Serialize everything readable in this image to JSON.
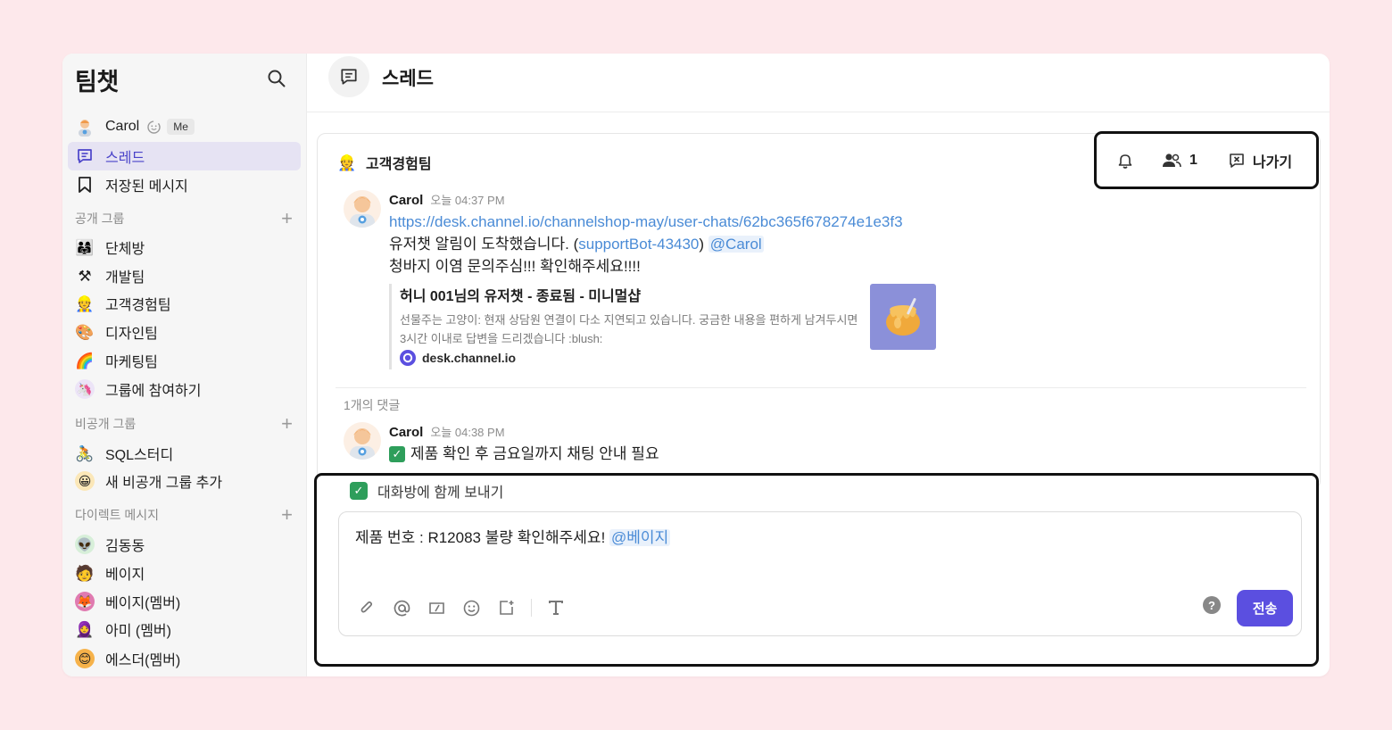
{
  "sidebar": {
    "title": "팀챗",
    "me": {
      "name": "Carol",
      "badge": "Me"
    },
    "nav": [
      {
        "label": "스레드",
        "icon": "thread-icon",
        "active": true
      },
      {
        "label": "저장된 메시지",
        "icon": "bookmark-icon",
        "active": false
      }
    ],
    "public_groups": {
      "header": "공개 그룹",
      "items": [
        {
          "label": "단체방",
          "icon": "family-emoji-icon"
        },
        {
          "label": "개발팀",
          "icon": "hammer-pick-icon"
        },
        {
          "label": "고객경험팀",
          "icon": "worker-emoji-icon"
        },
        {
          "label": "디자인팀",
          "icon": "palette-icon"
        },
        {
          "label": "마케팅팀",
          "icon": "rainbow-icon"
        },
        {
          "label": "그룹에 참여하기",
          "icon": "unicorn-icon"
        }
      ]
    },
    "private_groups": {
      "header": "비공개 그룹",
      "items": [
        {
          "label": "SQL스터디",
          "icon": "cyclist-lock-icon"
        },
        {
          "label": "새 비공개 그룹 추가",
          "icon": "smile-icon"
        }
      ]
    },
    "direct_messages": {
      "header": "다이렉트 메시지",
      "items": [
        {
          "label": "김동동",
          "icon": "alien-icon"
        },
        {
          "label": "베이지",
          "icon": "person-icon"
        },
        {
          "label": "베이지(멤버)",
          "icon": "fox-icon"
        },
        {
          "label": "아미 (멤버)",
          "icon": "person-moon-icon"
        },
        {
          "label": "에스더(멤버)",
          "icon": "blush-icon"
        }
      ]
    }
  },
  "header": {
    "title": "스레드"
  },
  "thread": {
    "group_name": "고객경험팀",
    "actions": {
      "member_count": "1",
      "leave_label": "나가기"
    },
    "message": {
      "author": "Carol",
      "time": "오늘 04:37 PM",
      "link": "https://desk.channel.io/channelshop-may/user-chats/62bc365f678274e1e3f3",
      "line2_prefix": "유저챗 알림이 도착했습니다. (",
      "line2_bot": "supportBot-43430",
      "line2_suffix": ")",
      "line2_mention": "@Carol",
      "line3": "청바지 이염 문의주심!!! 확인해주세요!!!!",
      "preview": {
        "title": "허니 001님의 유저챗 - 종료됨 - 미니멀샵",
        "description": "선물주는 고양이: 현재 상담원 연결이 다소 지연되고 있습니다. 궁금한 내용을 편하게 남겨두시면 3시간 이내로 답변을 드리겠습니다 :blush:",
        "site": "desk.channel.io"
      }
    },
    "reply_count": "1개의 댓글",
    "reply": {
      "author": "Carol",
      "time": "오늘 04:38 PM",
      "text": "제품 확인 후 금요일까지 채팅 안내 필요"
    }
  },
  "composer": {
    "also_send_label": "대화방에 함께 보내기",
    "also_send_checked": true,
    "text": "제품 번호 : R12083 불량 확인해주세요!",
    "mention": "@베이지",
    "send_label": "전송",
    "help_label": "?",
    "toolbar": [
      "attach-icon",
      "mention-icon",
      "shortcut-icon",
      "emoji-icon",
      "add-app-icon",
      "text-format-icon"
    ]
  },
  "colors": {
    "accent": "#5b4fe0",
    "active_bg": "#e6e3f3",
    "background": "#fde8eb",
    "link": "#4a8bd6"
  }
}
